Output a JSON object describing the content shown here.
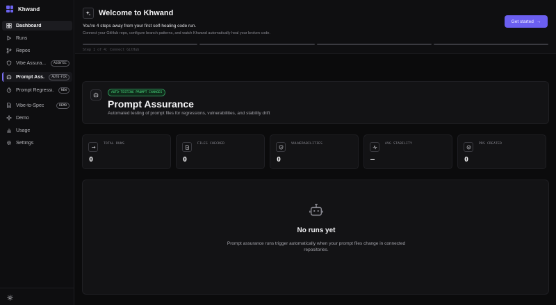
{
  "brand": {
    "name": "Khwand"
  },
  "sidebar": {
    "items": [
      {
        "label": "Dashboard",
        "icon": "dashboard-icon"
      },
      {
        "label": "Runs",
        "icon": "play-icon"
      },
      {
        "label": "Repos",
        "icon": "git-branch-icon"
      },
      {
        "label": "Vibe Assura...",
        "icon": "shield-icon",
        "badge": "AGENTIC"
      },
      {
        "label": "Prompt Ass...",
        "icon": "bot-icon",
        "badge": "AUTO-FIX"
      },
      {
        "label": "Prompt Regressi...",
        "icon": "stability-icon",
        "badge": "NEW"
      },
      {
        "label": "Vibe-to-Spec",
        "icon": "document-icon",
        "badge": "DEMO"
      },
      {
        "label": "Demo",
        "icon": "sparkle-icon"
      },
      {
        "label": "Usage",
        "icon": "chart-icon"
      },
      {
        "label": "Settings",
        "icon": "gear-icon"
      }
    ]
  },
  "welcome": {
    "title": "Welcome to Khwand",
    "subtitle": "You're 4 steps away from your first self-healing code run.",
    "description": "Connect your GitHub repo, configure branch patterns, and watch Khwand automatically heal your broken code.",
    "cta": "Get started",
    "step_label": "Step 1 of 4: Connect GitHub",
    "steps_total": 4,
    "steps_done": 0
  },
  "hero": {
    "badge": "AUTO-TESTING PROMPT CHANGES",
    "title": "Prompt Assurance",
    "description": "Automated testing of prompt files for regressions, vulnerabilities, and stability drift"
  },
  "stats": [
    {
      "label": "TOTAL RUNS",
      "value": "0",
      "icon": "runs-icon"
    },
    {
      "label": "FILES CHECKED",
      "value": "0",
      "icon": "file-icon"
    },
    {
      "label": "VULNERABILITIES",
      "value": "0",
      "icon": "shield-alert-icon"
    },
    {
      "label": "AVG STABILITY",
      "value": "—",
      "icon": "activity-icon"
    },
    {
      "label": "PRS CREATED",
      "value": "0",
      "icon": "pr-icon"
    }
  ],
  "empty": {
    "title": "No runs yet",
    "description": "Prompt assurance runs trigger automatically when your prompt files change in connected repositories."
  },
  "colors": {
    "accent": "#6b5ff0",
    "success": "#4ade80",
    "background": "#0b0b0c",
    "card": "#131315"
  }
}
